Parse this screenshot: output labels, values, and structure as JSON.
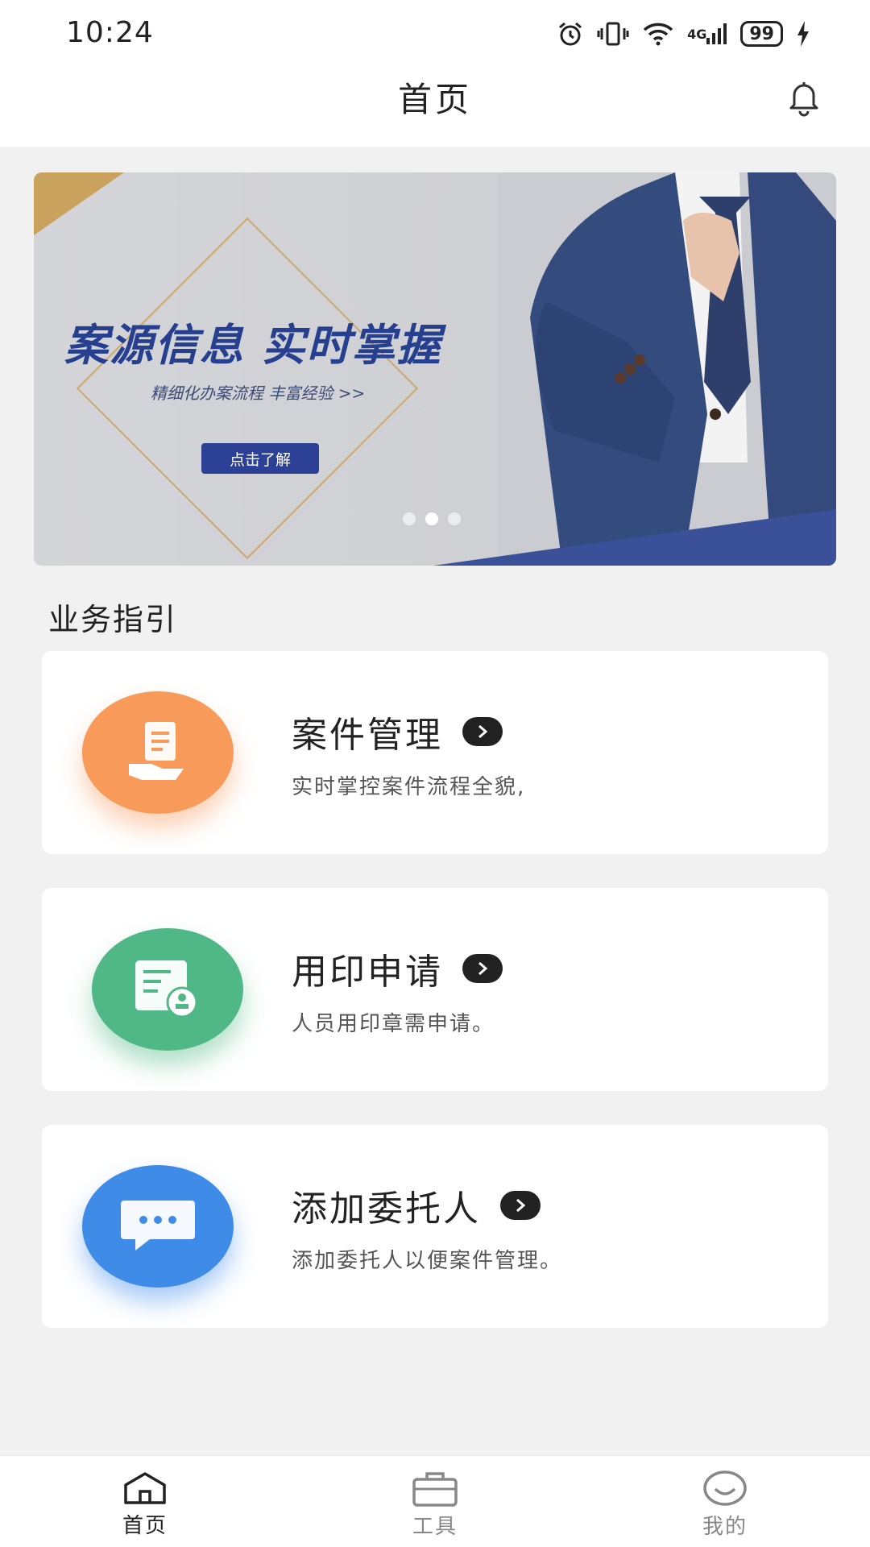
{
  "status_bar": {
    "time": "10:24",
    "network": "4G",
    "battery": "99",
    "icons": [
      "alarm-icon",
      "vibrate-icon",
      "wifi-icon",
      "signal-icon",
      "battery-icon",
      "charging-icon"
    ]
  },
  "header": {
    "title": "首页",
    "notification_icon": "bell-icon"
  },
  "banner": {
    "headline": "案源信息 实时掌握",
    "subtitle": "精细化办案流程  丰富经验 >>",
    "button_label": "点击了解",
    "slide_count": 3,
    "active_slide": 2
  },
  "guide": {
    "section_title": "业务指引",
    "cards": [
      {
        "title": "案件管理",
        "description": "实时掌控案件流程全貌,",
        "icon": "document-hand-icon",
        "color": "#f79a5a"
      },
      {
        "title": "用印申请",
        "description": "人员用印章需申请。",
        "icon": "seal-document-icon",
        "color": "#4fb886"
      },
      {
        "title": "添加委托人",
        "description": "添加委托人以便案件管理。",
        "icon": "chat-bubble-icon",
        "color": "#3f8ce8"
      }
    ]
  },
  "bottom_nav": {
    "items": [
      {
        "label": "首页",
        "icon": "home-icon",
        "active": true
      },
      {
        "label": "工具",
        "icon": "briefcase-icon",
        "active": false
      },
      {
        "label": "我的",
        "icon": "smile-icon",
        "active": false
      }
    ]
  }
}
